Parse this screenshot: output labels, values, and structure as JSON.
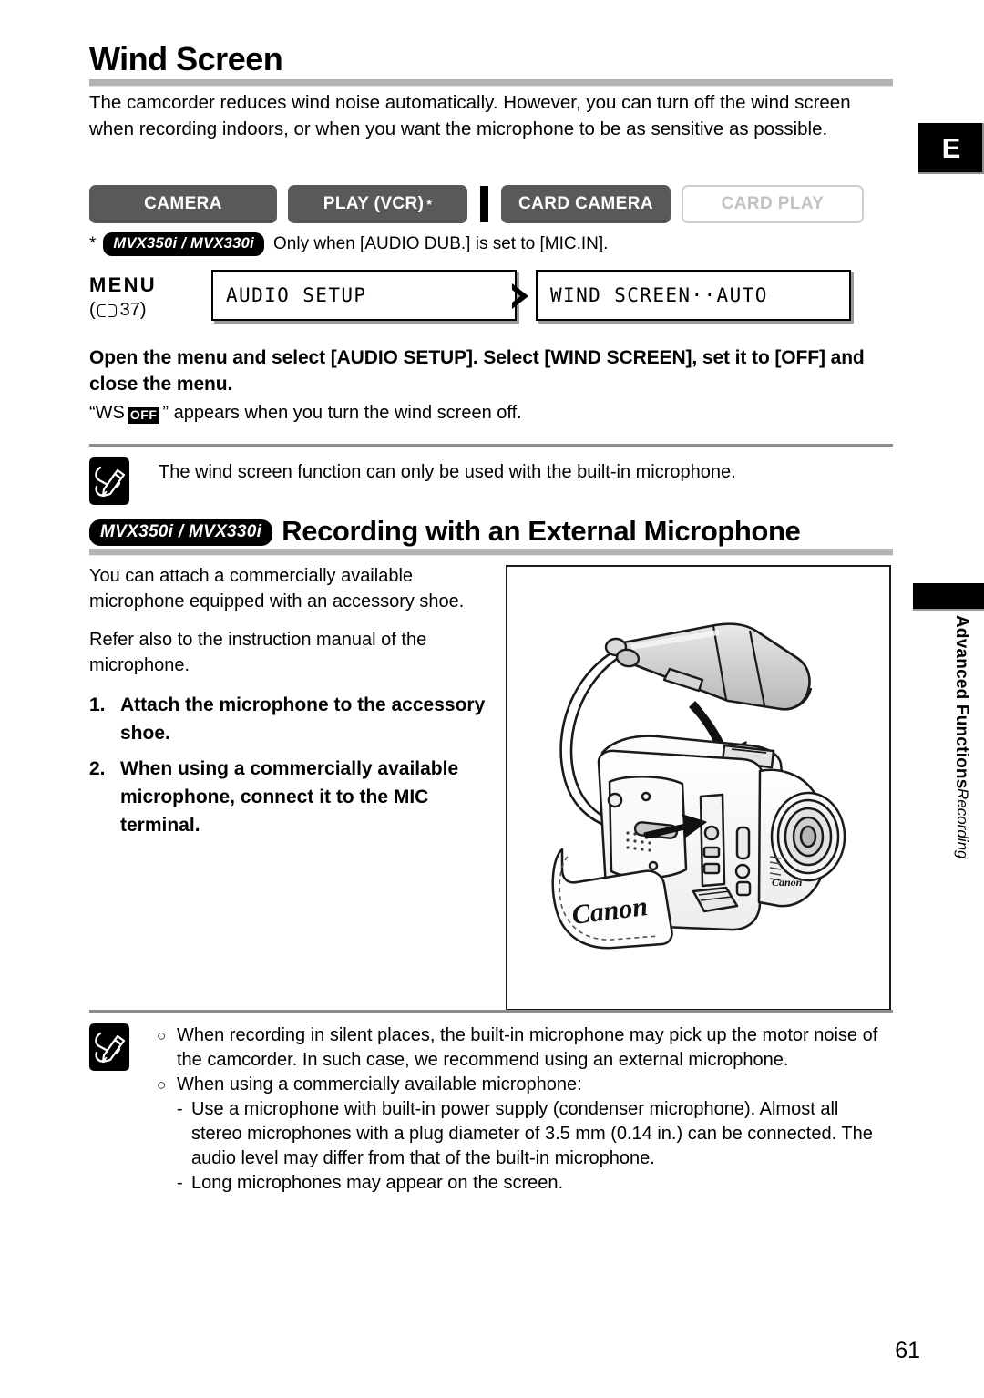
{
  "page": {
    "number": "61",
    "language_tab": "E"
  },
  "section_tab": {
    "main": "Advanced Functions",
    "sub": "Recording"
  },
  "wind_screen": {
    "heading": "Wind Screen",
    "intro": "The camcorder reduces wind noise automatically. However, you can turn off the wind screen when recording indoors, or when you want the microphone to be as sensitive as possible.",
    "modes": [
      {
        "label": "CAMERA",
        "state": "on",
        "star": ""
      },
      {
        "label": "PLAY (VCR)",
        "state": "on",
        "star": "*"
      },
      {
        "label": "CARD CAMERA",
        "state": "on",
        "star": ""
      },
      {
        "label": "CARD PLAY",
        "state": "off",
        "star": ""
      }
    ],
    "footnote": {
      "star": "*",
      "badge": "MVX350i / MVX330i",
      "text": "Only when [AUDIO DUB.] is set to [MIC.IN]."
    },
    "menu": {
      "label": "MENU",
      "ref_open": "(",
      "ref_page": "37",
      "ref_close": ")",
      "screen_1": "AUDIO SETUP",
      "screen_2": "WIND SCREEN··AUTO"
    },
    "instruction": "Open the menu and select [AUDIO SETUP]. Select [WIND SCREEN], set it to [OFF] and close the menu.",
    "note_quote_open": "“WS",
    "note_badge": "OFF",
    "note_quote_rest": "” appears when you turn the wind screen off.",
    "note": "The wind screen function can only be used with the built-in microphone."
  },
  "external_mic": {
    "badge": "MVX350i / MVX330i",
    "heading": "Recording with an External Microphone",
    "paragraphs": [
      "You can attach a commercially available microphone equipped with an accessory shoe.",
      "Refer also to the instruction manual of the microphone."
    ],
    "steps": [
      {
        "num": "1.",
        "text": "Attach the microphone to the accessory shoe."
      },
      {
        "num": "2.",
        "text": "When using a commercially available microphone, connect it to the MIC terminal."
      }
    ],
    "illustration": {
      "caption_brand": "Canon",
      "caption_brand_2": "Canon"
    },
    "notes": [
      {
        "mark": "○",
        "text": "When recording in silent places, the built-in microphone may pick up the motor noise of the camcorder. In such case, we recommend using an external microphone."
      },
      {
        "mark": "○",
        "text": "When using a commercially available microphone:",
        "sub": [
          {
            "mark": "-",
            "text": "Use a microphone with built-in power supply (condenser microphone). Almost all stereo microphones with a plug diameter of 3.5 mm (0.14 in.) can be connected. The audio level may differ from that of the built-in microphone."
          },
          {
            "mark": "-",
            "text": "Long microphones may appear on the screen."
          }
        ]
      }
    ]
  },
  "colors": {
    "mode_on_bg": "#595959",
    "mode_off_border": "#cfcfcf",
    "rule_gray": "#b3b3b3",
    "thin_rule": "#8c8c8c",
    "badge_black": "#000000"
  }
}
